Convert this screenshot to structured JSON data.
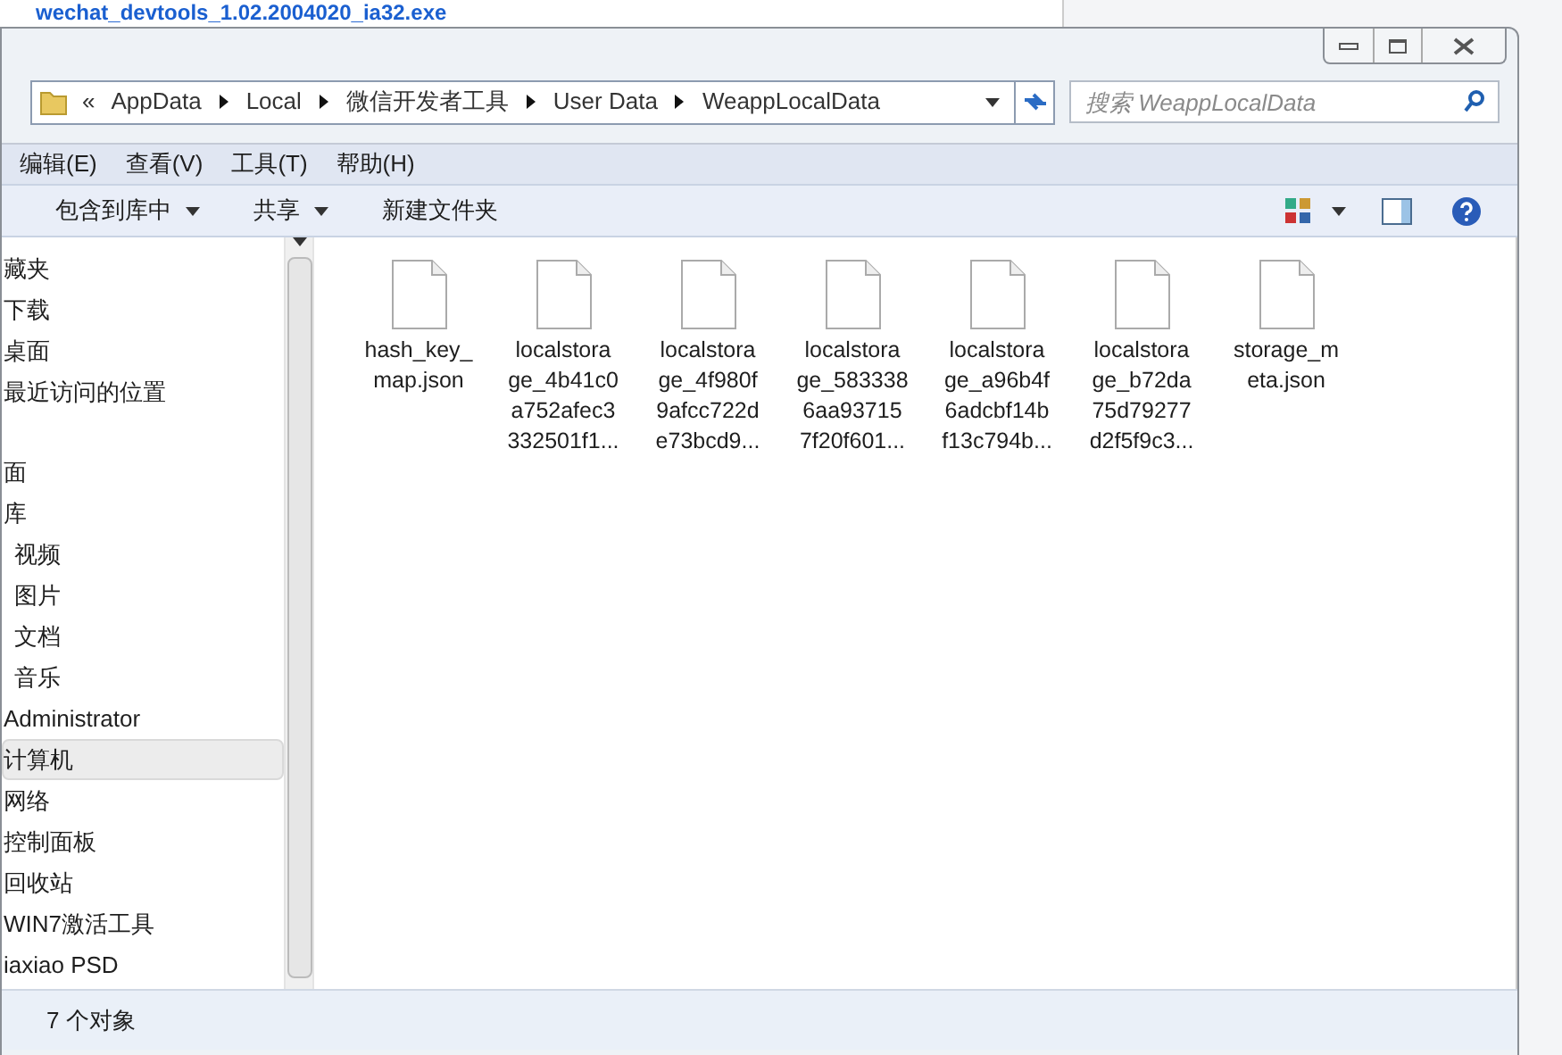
{
  "background_window": {
    "title": "wechat_devtools_1.02.2004020_ia32.exe"
  },
  "address_bar": {
    "overflow": "«",
    "segments": [
      "AppData",
      "Local",
      "微信开发者工具",
      "User Data",
      "WeappLocalData"
    ]
  },
  "search": {
    "placeholder": "搜索 WeappLocalData"
  },
  "menu": [
    "编辑(E)",
    "查看(V)",
    "工具(T)",
    "帮助(H)"
  ],
  "toolbar": [
    {
      "label": "包含到库中",
      "dropdown": true
    },
    {
      "label": "共享",
      "dropdown": true
    },
    {
      "label": "新建文件夹",
      "dropdown": false
    }
  ],
  "sidebar": {
    "items": [
      {
        "label": "藏夹",
        "selected": false,
        "children": [
          {
            "label": "下载",
            "selected": false
          },
          {
            "label": "桌面",
            "selected": false
          },
          {
            "label": "最近访问的位置",
            "selected": false
          }
        ]
      },
      {
        "label": "面",
        "selected": false,
        "children": [
          {
            "label": "库",
            "selected": false,
            "children": [
              {
                "label": "视频",
                "selected": false
              },
              {
                "label": "图片",
                "selected": false
              },
              {
                "label": "文档",
                "selected": false
              },
              {
                "label": "音乐",
                "selected": false
              }
            ]
          },
          {
            "label": "Administrator",
            "selected": false
          },
          {
            "label": "计算机",
            "selected": true
          },
          {
            "label": "网络",
            "selected": false
          },
          {
            "label": "控制面板",
            "selected": false
          },
          {
            "label": "回收站",
            "selected": false
          },
          {
            "label": "WIN7激活工具",
            "selected": false
          },
          {
            "label": "iaxiao PSD",
            "selected": false
          }
        ]
      }
    ]
  },
  "files": [
    {
      "name": "hash_key_\nmap.json"
    },
    {
      "name": "localstora\nge_4b41c0\na752afec3\n332501f1..."
    },
    {
      "name": "localstora\nge_4f980f\n9afcc722d\ne73bcd9..."
    },
    {
      "name": "localstora\nge_583338\n6aa93715\n7f20f601..."
    },
    {
      "name": "localstora\nge_a96b4f\n6adcbf14b\nf13c794b..."
    },
    {
      "name": "localstora\nge_b72da\n75d79277\nd2f5f9c3..."
    },
    {
      "name": "storage_m\neta.json"
    }
  ],
  "status_bar": {
    "count": "7 个对象"
  }
}
